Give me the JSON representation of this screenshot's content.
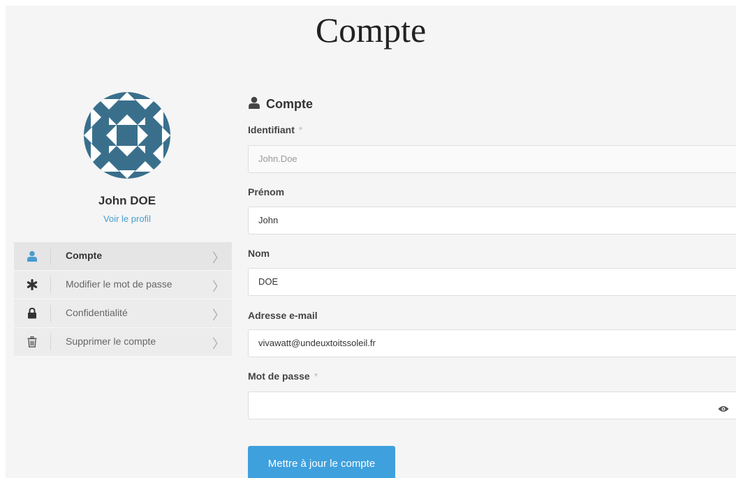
{
  "page": {
    "title": "Compte"
  },
  "profile": {
    "name": "John DOE",
    "profile_link": "Voir le profil",
    "avatar_color": "#3a6f8c"
  },
  "side_menu": {
    "items": [
      {
        "label": "Compte",
        "icon": "user-icon",
        "active": true
      },
      {
        "label": "Modifier le mot de passe",
        "icon": "asterisk-icon",
        "active": false
      },
      {
        "label": "Confidentialité",
        "icon": "lock-icon",
        "active": false
      },
      {
        "label": "Supprimer le compte",
        "icon": "trash-icon",
        "active": false
      }
    ],
    "chevron": "〉"
  },
  "form": {
    "title": "Compte",
    "required_mark": "*",
    "fields": {
      "username": {
        "label": "Identifiant",
        "value": "John.Doe",
        "required": true,
        "disabled": true
      },
      "first_name": {
        "label": "Prénom",
        "value": "John"
      },
      "last_name": {
        "label": "Nom",
        "value": "DOE"
      },
      "email": {
        "label": "Adresse e-mail",
        "value": "vivawatt@undeuxtoitssoleil.fr"
      },
      "password": {
        "label": "Mot de passe",
        "value": "",
        "required": true
      }
    },
    "submit_label": "Mettre à jour le compte"
  },
  "colors": {
    "accent": "#3fa0de",
    "link": "#4a9ccf",
    "active_icon": "#4a9ccf"
  }
}
